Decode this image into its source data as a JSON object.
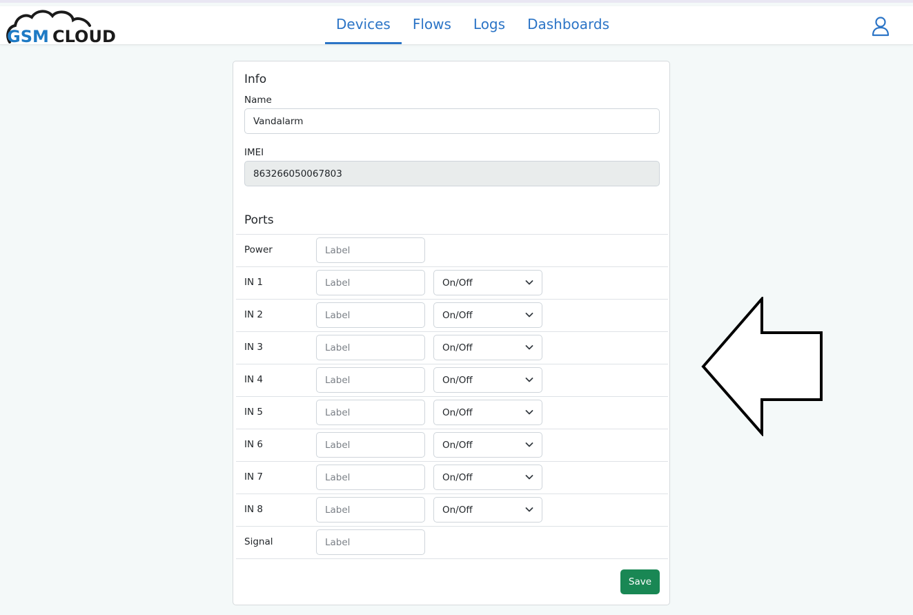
{
  "app": {
    "logo_text_left": "GSM",
    "logo_text_right": "CLOUD"
  },
  "nav": {
    "tabs": [
      {
        "label": "Devices",
        "active": true
      },
      {
        "label": "Flows",
        "active": false
      },
      {
        "label": "Logs",
        "active": false
      },
      {
        "label": "Dashboards",
        "active": false
      }
    ],
    "user_icon": "user-icon"
  },
  "info": {
    "title": "Info",
    "name_label": "Name",
    "name_value": "Vandalarm",
    "imei_label": "IMEI",
    "imei_value": "863266050067803"
  },
  "ports": {
    "title": "Ports",
    "rows": [
      {
        "name": "Power",
        "placeholder": "Label",
        "mode": null
      },
      {
        "name": "IN 1",
        "placeholder": "Label",
        "mode": "On/Off"
      },
      {
        "name": "IN 2",
        "placeholder": "Label",
        "mode": "On/Off"
      },
      {
        "name": "IN 3",
        "placeholder": "Label",
        "mode": "On/Off"
      },
      {
        "name": "IN 4",
        "placeholder": "Label",
        "mode": "On/Off"
      },
      {
        "name": "IN 5",
        "placeholder": "Label",
        "mode": "On/Off"
      },
      {
        "name": "IN 6",
        "placeholder": "Label",
        "mode": "On/Off"
      },
      {
        "name": "IN 7",
        "placeholder": "Label",
        "mode": "On/Off"
      },
      {
        "name": "IN 8",
        "placeholder": "Label",
        "mode": "On/Off"
      },
      {
        "name": "Signal",
        "placeholder": "Label",
        "mode": null
      }
    ]
  },
  "actions": {
    "save_label": "Save"
  },
  "colors": {
    "accent": "#2b74c6",
    "save": "#198754",
    "logo_blue": "#1e7ac4",
    "logo_dark": "#1b1b1b"
  }
}
